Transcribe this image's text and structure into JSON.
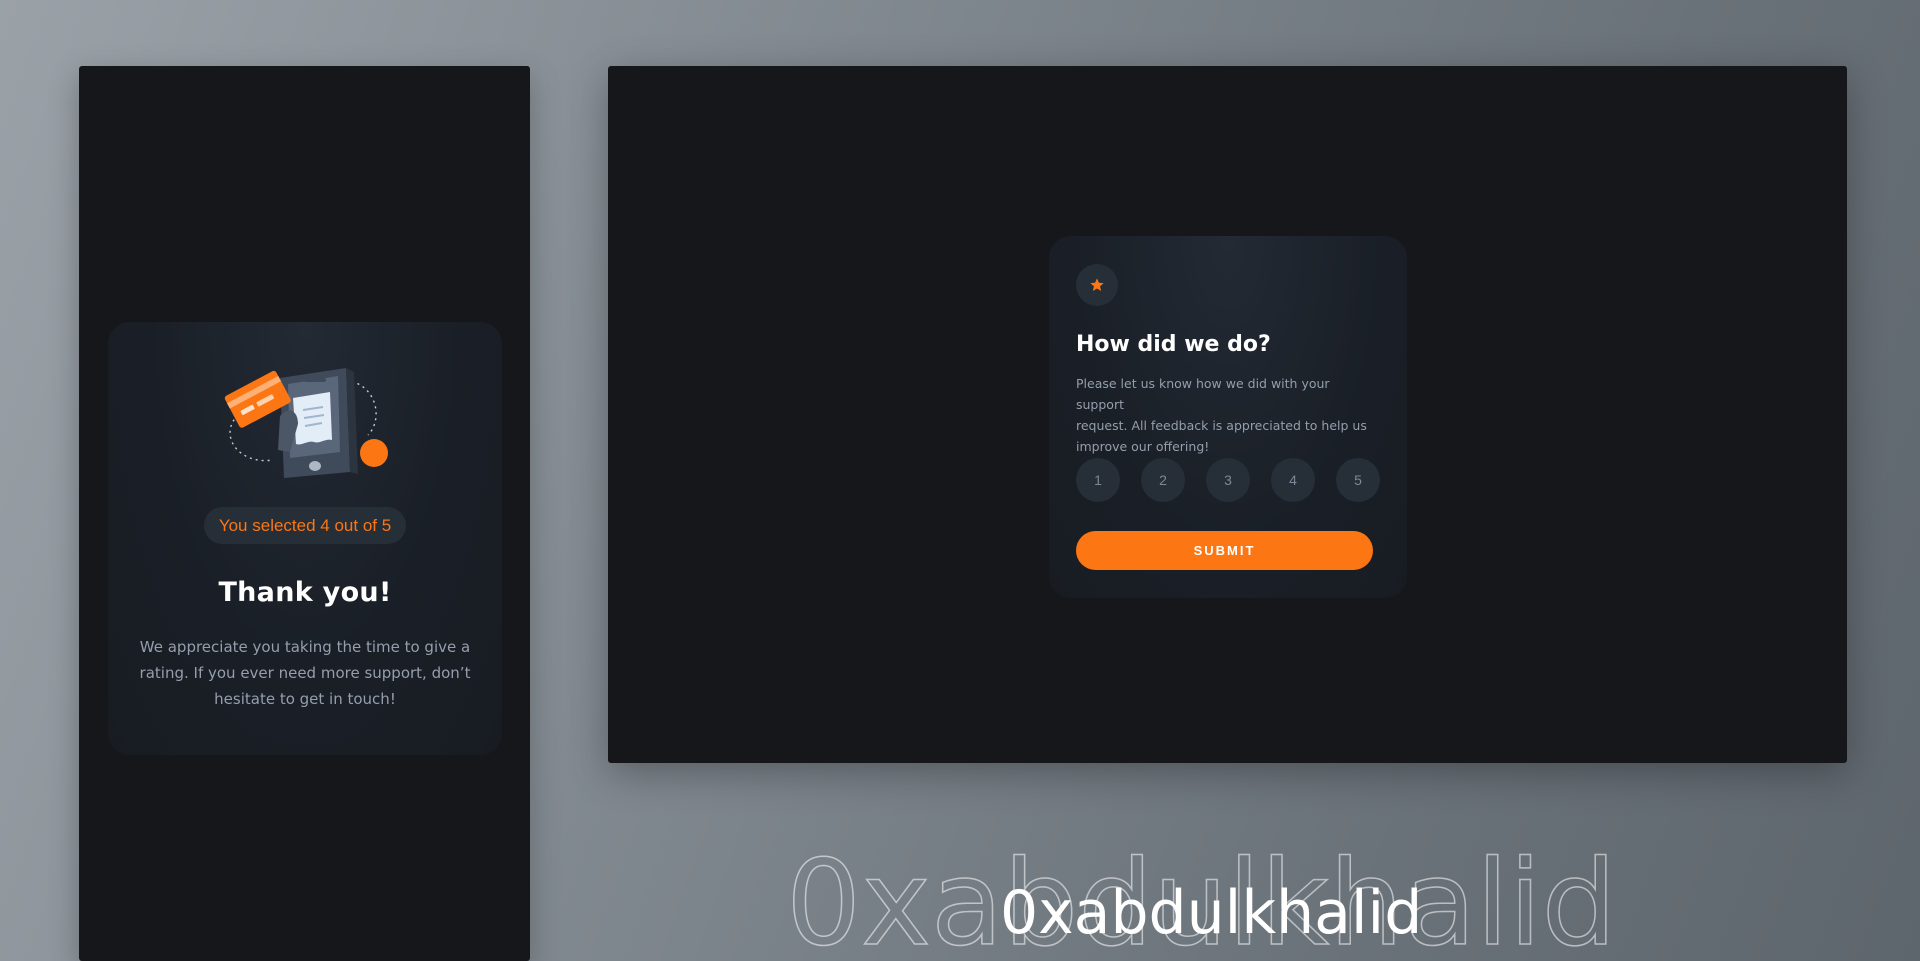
{
  "thank_you_card": {
    "selected_text": "You selected 4 out of 5",
    "title": "Thank you!",
    "message_lines": [
      "We appreciate you taking the time to give a",
      "rating. If you ever need more support, don’t",
      "hesitate to get in touch!"
    ]
  },
  "rating_card": {
    "icon": "star-icon",
    "title": "How did we do?",
    "description_lines": [
      "Please let us know how we did with your support",
      "request. All feedback is appreciated to help us",
      "improve our offering!"
    ],
    "ratings": [
      "1",
      "2",
      "3",
      "4",
      "5"
    ],
    "submit_label": "SUBMIT"
  },
  "watermark": {
    "text": "0xabdulkhalid"
  },
  "colors": {
    "accent": "#fc7614",
    "card_bg": "#1a1f27",
    "frame_bg": "#15171b",
    "muted_text": "#959eac",
    "rating_circle": "#262e38"
  }
}
